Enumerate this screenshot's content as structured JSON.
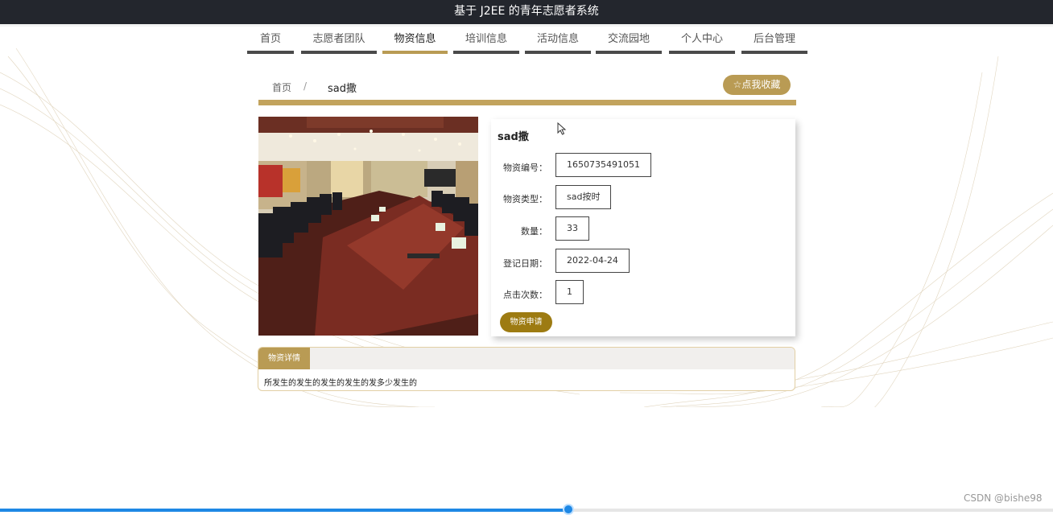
{
  "header": {
    "title": "基于 J2EE 的青年志愿者系统"
  },
  "nav": {
    "items": [
      {
        "label": "首页",
        "active": false
      },
      {
        "label": "志愿者团队",
        "active": false
      },
      {
        "label": "物资信息",
        "active": true
      },
      {
        "label": "培训信息",
        "active": false
      },
      {
        "label": "活动信息",
        "active": false
      },
      {
        "label": "交流园地",
        "active": false
      },
      {
        "label": "个人中心",
        "active": false
      },
      {
        "label": "后台管理",
        "active": false
      }
    ]
  },
  "breadcrumb": {
    "home": "首页",
    "separator": "/",
    "current": "sad撒"
  },
  "favorite_button": {
    "icon": "star-outline-icon",
    "label": "点我收藏"
  },
  "item": {
    "name": "sad撒",
    "fields": [
      {
        "label": "物资编号：",
        "value": "1650735491051"
      },
      {
        "label": "物资类型：",
        "value": "sad按时"
      },
      {
        "label": "数量：",
        "value": "33"
      },
      {
        "label": "登记日期：",
        "value": "2022-04-24"
      },
      {
        "label": "点击次数：",
        "value": "1"
      }
    ],
    "apply_button": "物资申请"
  },
  "detail": {
    "tab_label": "物资详情",
    "content": "所发生的发生的发生的发生的发多少发生的"
  },
  "watermark": "CSDN @bishe98",
  "video_progress": {
    "played_fraction": 0.54
  },
  "colors": {
    "header_bg": "#23262d",
    "accent_gold": "#b99b54",
    "gold_line": "#c2a35d",
    "apply_button": "#9d7b12",
    "progress_blue": "#1e88e5"
  }
}
